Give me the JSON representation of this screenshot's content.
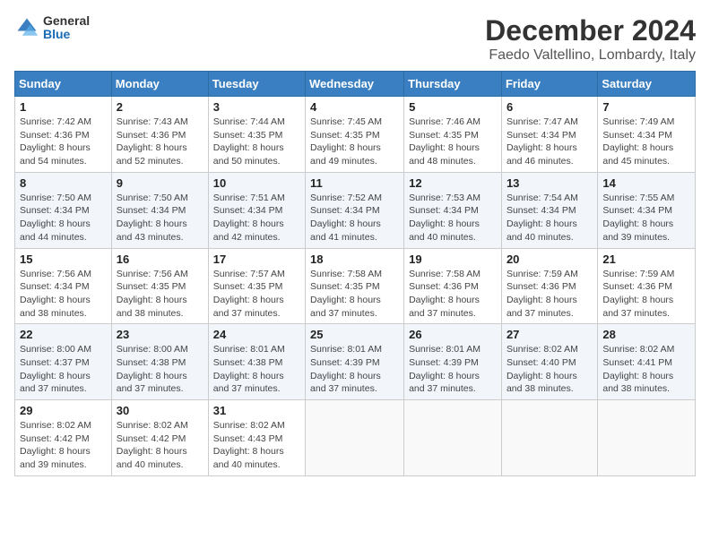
{
  "logo": {
    "general": "General",
    "blue": "Blue"
  },
  "header": {
    "month": "December 2024",
    "location": "Faedo Valtellino, Lombardy, Italy"
  },
  "weekdays": [
    "Sunday",
    "Monday",
    "Tuesday",
    "Wednesday",
    "Thursday",
    "Friday",
    "Saturday"
  ],
  "weeks": [
    [
      {
        "day": "1",
        "detail": "Sunrise: 7:42 AM\nSunset: 4:36 PM\nDaylight: 8 hours\nand 54 minutes."
      },
      {
        "day": "2",
        "detail": "Sunrise: 7:43 AM\nSunset: 4:36 PM\nDaylight: 8 hours\nand 52 minutes."
      },
      {
        "day": "3",
        "detail": "Sunrise: 7:44 AM\nSunset: 4:35 PM\nDaylight: 8 hours\nand 50 minutes."
      },
      {
        "day": "4",
        "detail": "Sunrise: 7:45 AM\nSunset: 4:35 PM\nDaylight: 8 hours\nand 49 minutes."
      },
      {
        "day": "5",
        "detail": "Sunrise: 7:46 AM\nSunset: 4:35 PM\nDaylight: 8 hours\nand 48 minutes."
      },
      {
        "day": "6",
        "detail": "Sunrise: 7:47 AM\nSunset: 4:34 PM\nDaylight: 8 hours\nand 46 minutes."
      },
      {
        "day": "7",
        "detail": "Sunrise: 7:49 AM\nSunset: 4:34 PM\nDaylight: 8 hours\nand 45 minutes."
      }
    ],
    [
      {
        "day": "8",
        "detail": "Sunrise: 7:50 AM\nSunset: 4:34 PM\nDaylight: 8 hours\nand 44 minutes."
      },
      {
        "day": "9",
        "detail": "Sunrise: 7:50 AM\nSunset: 4:34 PM\nDaylight: 8 hours\nand 43 minutes."
      },
      {
        "day": "10",
        "detail": "Sunrise: 7:51 AM\nSunset: 4:34 PM\nDaylight: 8 hours\nand 42 minutes."
      },
      {
        "day": "11",
        "detail": "Sunrise: 7:52 AM\nSunset: 4:34 PM\nDaylight: 8 hours\nand 41 minutes."
      },
      {
        "day": "12",
        "detail": "Sunrise: 7:53 AM\nSunset: 4:34 PM\nDaylight: 8 hours\nand 40 minutes."
      },
      {
        "day": "13",
        "detail": "Sunrise: 7:54 AM\nSunset: 4:34 PM\nDaylight: 8 hours\nand 40 minutes."
      },
      {
        "day": "14",
        "detail": "Sunrise: 7:55 AM\nSunset: 4:34 PM\nDaylight: 8 hours\nand 39 minutes."
      }
    ],
    [
      {
        "day": "15",
        "detail": "Sunrise: 7:56 AM\nSunset: 4:34 PM\nDaylight: 8 hours\nand 38 minutes."
      },
      {
        "day": "16",
        "detail": "Sunrise: 7:56 AM\nSunset: 4:35 PM\nDaylight: 8 hours\nand 38 minutes."
      },
      {
        "day": "17",
        "detail": "Sunrise: 7:57 AM\nSunset: 4:35 PM\nDaylight: 8 hours\nand 37 minutes."
      },
      {
        "day": "18",
        "detail": "Sunrise: 7:58 AM\nSunset: 4:35 PM\nDaylight: 8 hours\nand 37 minutes."
      },
      {
        "day": "19",
        "detail": "Sunrise: 7:58 AM\nSunset: 4:36 PM\nDaylight: 8 hours\nand 37 minutes."
      },
      {
        "day": "20",
        "detail": "Sunrise: 7:59 AM\nSunset: 4:36 PM\nDaylight: 8 hours\nand 37 minutes."
      },
      {
        "day": "21",
        "detail": "Sunrise: 7:59 AM\nSunset: 4:36 PM\nDaylight: 8 hours\nand 37 minutes."
      }
    ],
    [
      {
        "day": "22",
        "detail": "Sunrise: 8:00 AM\nSunset: 4:37 PM\nDaylight: 8 hours\nand 37 minutes."
      },
      {
        "day": "23",
        "detail": "Sunrise: 8:00 AM\nSunset: 4:38 PM\nDaylight: 8 hours\nand 37 minutes."
      },
      {
        "day": "24",
        "detail": "Sunrise: 8:01 AM\nSunset: 4:38 PM\nDaylight: 8 hours\nand 37 minutes."
      },
      {
        "day": "25",
        "detail": "Sunrise: 8:01 AM\nSunset: 4:39 PM\nDaylight: 8 hours\nand 37 minutes."
      },
      {
        "day": "26",
        "detail": "Sunrise: 8:01 AM\nSunset: 4:39 PM\nDaylight: 8 hours\nand 37 minutes."
      },
      {
        "day": "27",
        "detail": "Sunrise: 8:02 AM\nSunset: 4:40 PM\nDaylight: 8 hours\nand 38 minutes."
      },
      {
        "day": "28",
        "detail": "Sunrise: 8:02 AM\nSunset: 4:41 PM\nDaylight: 8 hours\nand 38 minutes."
      }
    ],
    [
      {
        "day": "29",
        "detail": "Sunrise: 8:02 AM\nSunset: 4:42 PM\nDaylight: 8 hours\nand 39 minutes."
      },
      {
        "day": "30",
        "detail": "Sunrise: 8:02 AM\nSunset: 4:42 PM\nDaylight: 8 hours\nand 40 minutes."
      },
      {
        "day": "31",
        "detail": "Sunrise: 8:02 AM\nSunset: 4:43 PM\nDaylight: 8 hours\nand 40 minutes."
      },
      null,
      null,
      null,
      null
    ]
  ]
}
